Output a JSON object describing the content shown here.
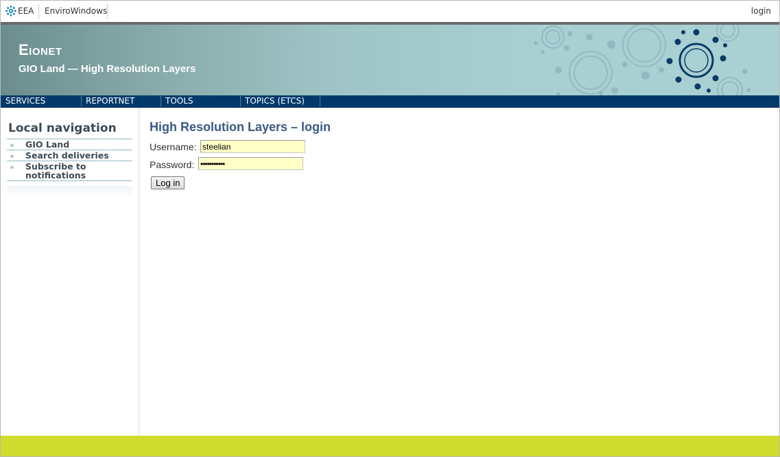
{
  "toplinks": {
    "eea": "EEA",
    "envirowindows": "EnviroWindows",
    "login": "login"
  },
  "header": {
    "title": "Eionet",
    "subtitle": "GIO Land — High Resolution Layers"
  },
  "nav": {
    "items": [
      "SERVICES",
      "REPORTNET",
      "TOOLS",
      "TOPICS (ETCS)"
    ]
  },
  "sidebar": {
    "title": "Local navigation",
    "items": [
      {
        "label": "GIO Land"
      },
      {
        "label": "Search deliveries"
      },
      {
        "label": "Subscribe to notifications"
      }
    ]
  },
  "main": {
    "title": "High Resolution Layers – login",
    "username_label": "Username:",
    "username_value": "steelian",
    "password_label": "Password:",
    "password_value": "•••••••••••",
    "login_button": "Log in"
  },
  "colors": {
    "navbar": "#003a6b",
    "footer": "#cfdc2e",
    "title": "#3a5a82",
    "input_bg": "#ffffc8"
  }
}
